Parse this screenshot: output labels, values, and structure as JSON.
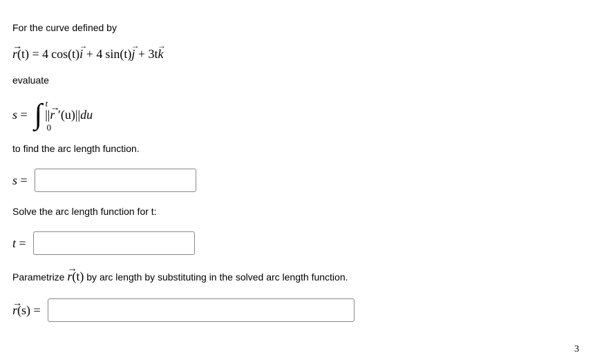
{
  "intro1": "For the curve defined by",
  "curve": {
    "lhs": "r",
    "arg": "(t)",
    "eq": " = ",
    "term1a": "4",
    "term1b": "cos",
    "term1c": "(t)",
    "unit_i": "i",
    "plus1": " + ",
    "term2a": "4",
    "term2b": "sin",
    "term2c": "(t)",
    "unit_j": "j",
    "plus2": " + ",
    "term3a": "3t",
    "unit_k": "k"
  },
  "intro2": "evaluate",
  "arclen_def": {
    "s": "s",
    "eq": " = ",
    "int_lb": "0",
    "int_ub": "t",
    "bars_open": "||",
    "r": "r",
    "prime": " ′",
    "arg": "(u)",
    "bars_close": "||",
    "du": "du"
  },
  "intro3": "to find the arc length function.",
  "ans_s": {
    "lhs_s": "s",
    "eq": " = "
  },
  "prompt_t": "Solve the arc length function for t:",
  "ans_t": {
    "lhs_t": "t",
    "eq": " = "
  },
  "prompt_r_pre": "Parametrize ",
  "prompt_r_vec": "r",
  "prompt_r_arg": "(t)",
  "prompt_r_post": " by arc length by substituting in the solved arc length function.",
  "ans_r": {
    "r": "r",
    "arg": "(s)",
    "eq": " = "
  },
  "footnote": "3"
}
